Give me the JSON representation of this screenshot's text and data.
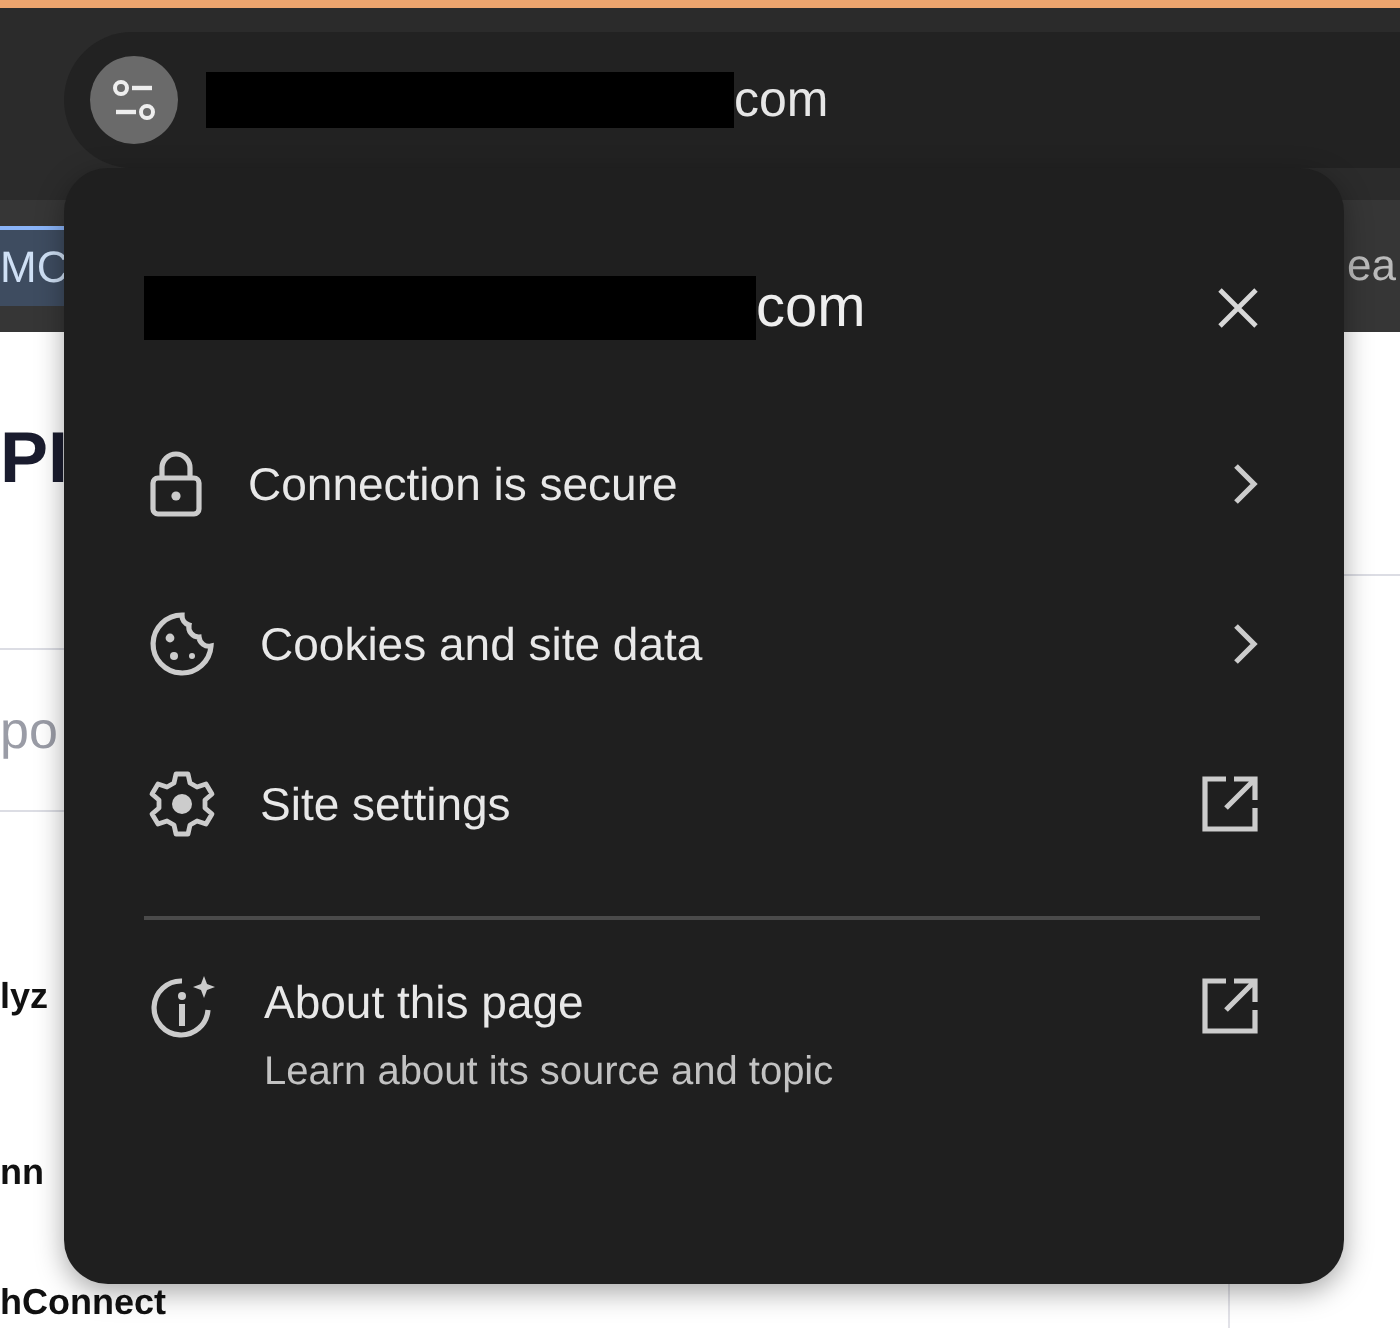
{
  "address_bar": {
    "domain_suffix": "com"
  },
  "bookmarks": {
    "left": "MC",
    "right": "ea"
  },
  "page_fragments": {
    "heading": "PI",
    "placeholder": "po",
    "items": [
      "lyz",
      "nn",
      "hConnect"
    ]
  },
  "popup": {
    "domain_suffix": "com",
    "rows": [
      {
        "kind": "lock",
        "label": "Connection is secure",
        "external": false
      },
      {
        "kind": "cookie",
        "label": "Cookies and site data",
        "external": false
      },
      {
        "kind": "gear",
        "label": "Site settings",
        "external": true
      }
    ],
    "about": {
      "label": "About this page",
      "subtitle": "Learn about its source and topic",
      "external": true
    }
  }
}
